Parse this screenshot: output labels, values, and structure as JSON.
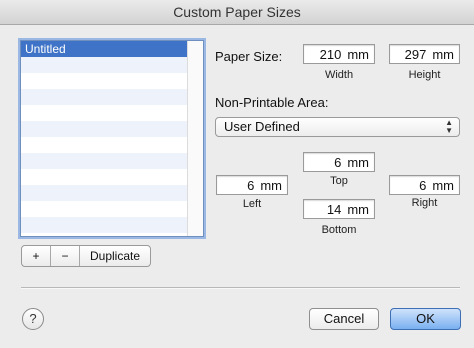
{
  "window": {
    "title": "Custom Paper Sizes"
  },
  "list": {
    "items": [
      "Untitled"
    ]
  },
  "list_buttons": {
    "add": "+",
    "remove": "−",
    "duplicate": "Duplicate"
  },
  "paper_size": {
    "label": "Paper Size:",
    "width": {
      "value": "210",
      "unit": "mm",
      "caption": "Width"
    },
    "height": {
      "value": "297",
      "unit": "mm",
      "caption": "Height"
    }
  },
  "non_printable": {
    "label": "Non-Printable Area:",
    "selected": "User Defined",
    "top": {
      "value": "6",
      "unit": "mm",
      "caption": "Top"
    },
    "left": {
      "value": "6",
      "unit": "mm",
      "caption": "Left"
    },
    "right": {
      "value": "6",
      "unit": "mm",
      "caption": "Right"
    },
    "bottom": {
      "value": "14",
      "unit": "mm",
      "caption": "Bottom"
    }
  },
  "footer": {
    "help": "?",
    "cancel": "Cancel",
    "ok": "OK"
  },
  "colors": {
    "selection": "#3e73c7",
    "default_button": "#7ab0f0"
  }
}
